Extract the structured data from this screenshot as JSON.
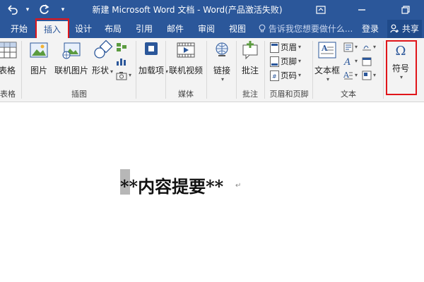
{
  "titlebar": {
    "title": "新建 Microsoft Word 文档 - Word(产品激活失败)",
    "undo_icon": "undo-icon",
    "redo_icon": "redo-icon",
    "customize_icon": "chevron-down-icon",
    "ribbon_display_icon": "ribbon-display-icon",
    "minimize_icon": "minimize-icon",
    "restore_icon": "restore-icon"
  },
  "tabs": {
    "start": "开始",
    "insert": "插入",
    "design": "设计",
    "layout": "布局",
    "references": "引用",
    "mailings": "邮件",
    "review": "审阅",
    "view": "视图"
  },
  "tellme": "告诉我您想要做什么...",
  "login": "登录",
  "share": "共享",
  "ribbon": {
    "tables": {
      "button": "表格",
      "group": "表格"
    },
    "illustrations": {
      "group": "插图",
      "picture": "图片",
      "online_picture": "联机图片",
      "shapes": "形状"
    },
    "addins": {
      "button": "加载项"
    },
    "media": {
      "group": "媒体",
      "online_video": "联机视频"
    },
    "links": {
      "button": "链接"
    },
    "comments": {
      "group": "批注",
      "comment": "批注"
    },
    "header_footer": {
      "group": "页眉和页脚",
      "header": "页眉",
      "footer": "页脚",
      "page_number": "页码"
    },
    "text": {
      "group": "文本",
      "textbox": "文本框"
    },
    "symbols": {
      "symbol": "符号",
      "omega": "Ω"
    }
  },
  "document": {
    "content": "**内容提要**",
    "paragraph_mark": "↵"
  },
  "colors": {
    "brand": "#2b579a",
    "highlight_box": "#e0151a"
  }
}
